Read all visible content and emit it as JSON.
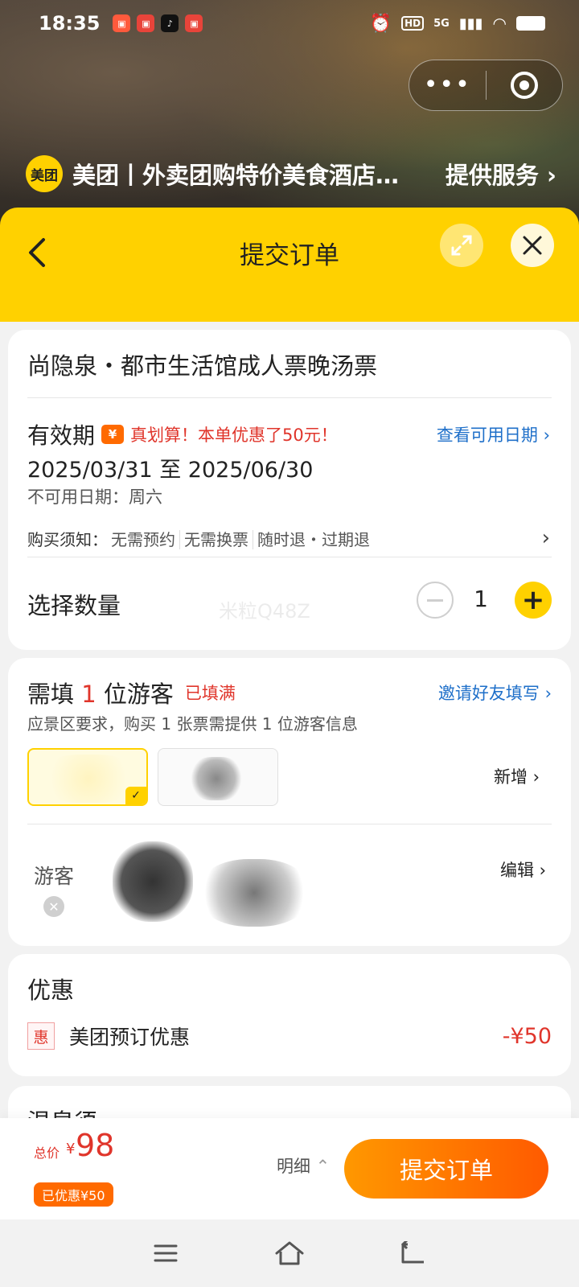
{
  "statusbar": {
    "time": "18:35",
    "network": "5G",
    "hd": "HD",
    "apps": [
      "app-icon-1",
      "app-icon-2",
      "tiktok-icon",
      "app-icon-4"
    ]
  },
  "provider": {
    "logo_text": "美团",
    "name": "美团丨外卖团购特价美食酒店…",
    "service": "提供服务"
  },
  "header": {
    "title": "提交订单"
  },
  "product": {
    "title": "尚隐泉・都市生活馆成人票晚汤票",
    "valid_label": "有效期",
    "yen_badge": "¥",
    "promo": "真划算！本单优惠了50元！",
    "view_dates": "查看可用日期",
    "dates": "2025/03/31 至 2025/06/30",
    "unavailable": "不可用日期：周六",
    "notice_label": "购买须知：",
    "notice_tags": [
      "无需预约",
      "无需换票",
      "随时退・过期退"
    ],
    "qty_label": "选择数量",
    "qty": "1",
    "watermark": "米粒Q48Z"
  },
  "guests": {
    "title_pre": "需填 ",
    "title_num": "1",
    "title_post": " 位游客",
    "filled": "已填满",
    "invite": "邀请好友填写",
    "subtitle": "应景区要求，购买 1 张票需提供 1 位游客信息",
    "add_new": "新增",
    "row_label": "游客",
    "edit": "编辑"
  },
  "discount": {
    "title": "优惠",
    "tag": "惠",
    "name": "美团预订优惠",
    "amount": "-¥50"
  },
  "next_section": {
    "title": "温泉须"
  },
  "bottom": {
    "total_label": "总价",
    "currency": "¥",
    "total": "98",
    "saved": "已优惠¥50",
    "detail": "明细",
    "submit": "提交订单"
  },
  "colors": {
    "brand_yellow": "#ffd100",
    "accent_orange": "#ff6a00",
    "price_red": "#e0352b",
    "link_blue": "#1e6fc9"
  }
}
